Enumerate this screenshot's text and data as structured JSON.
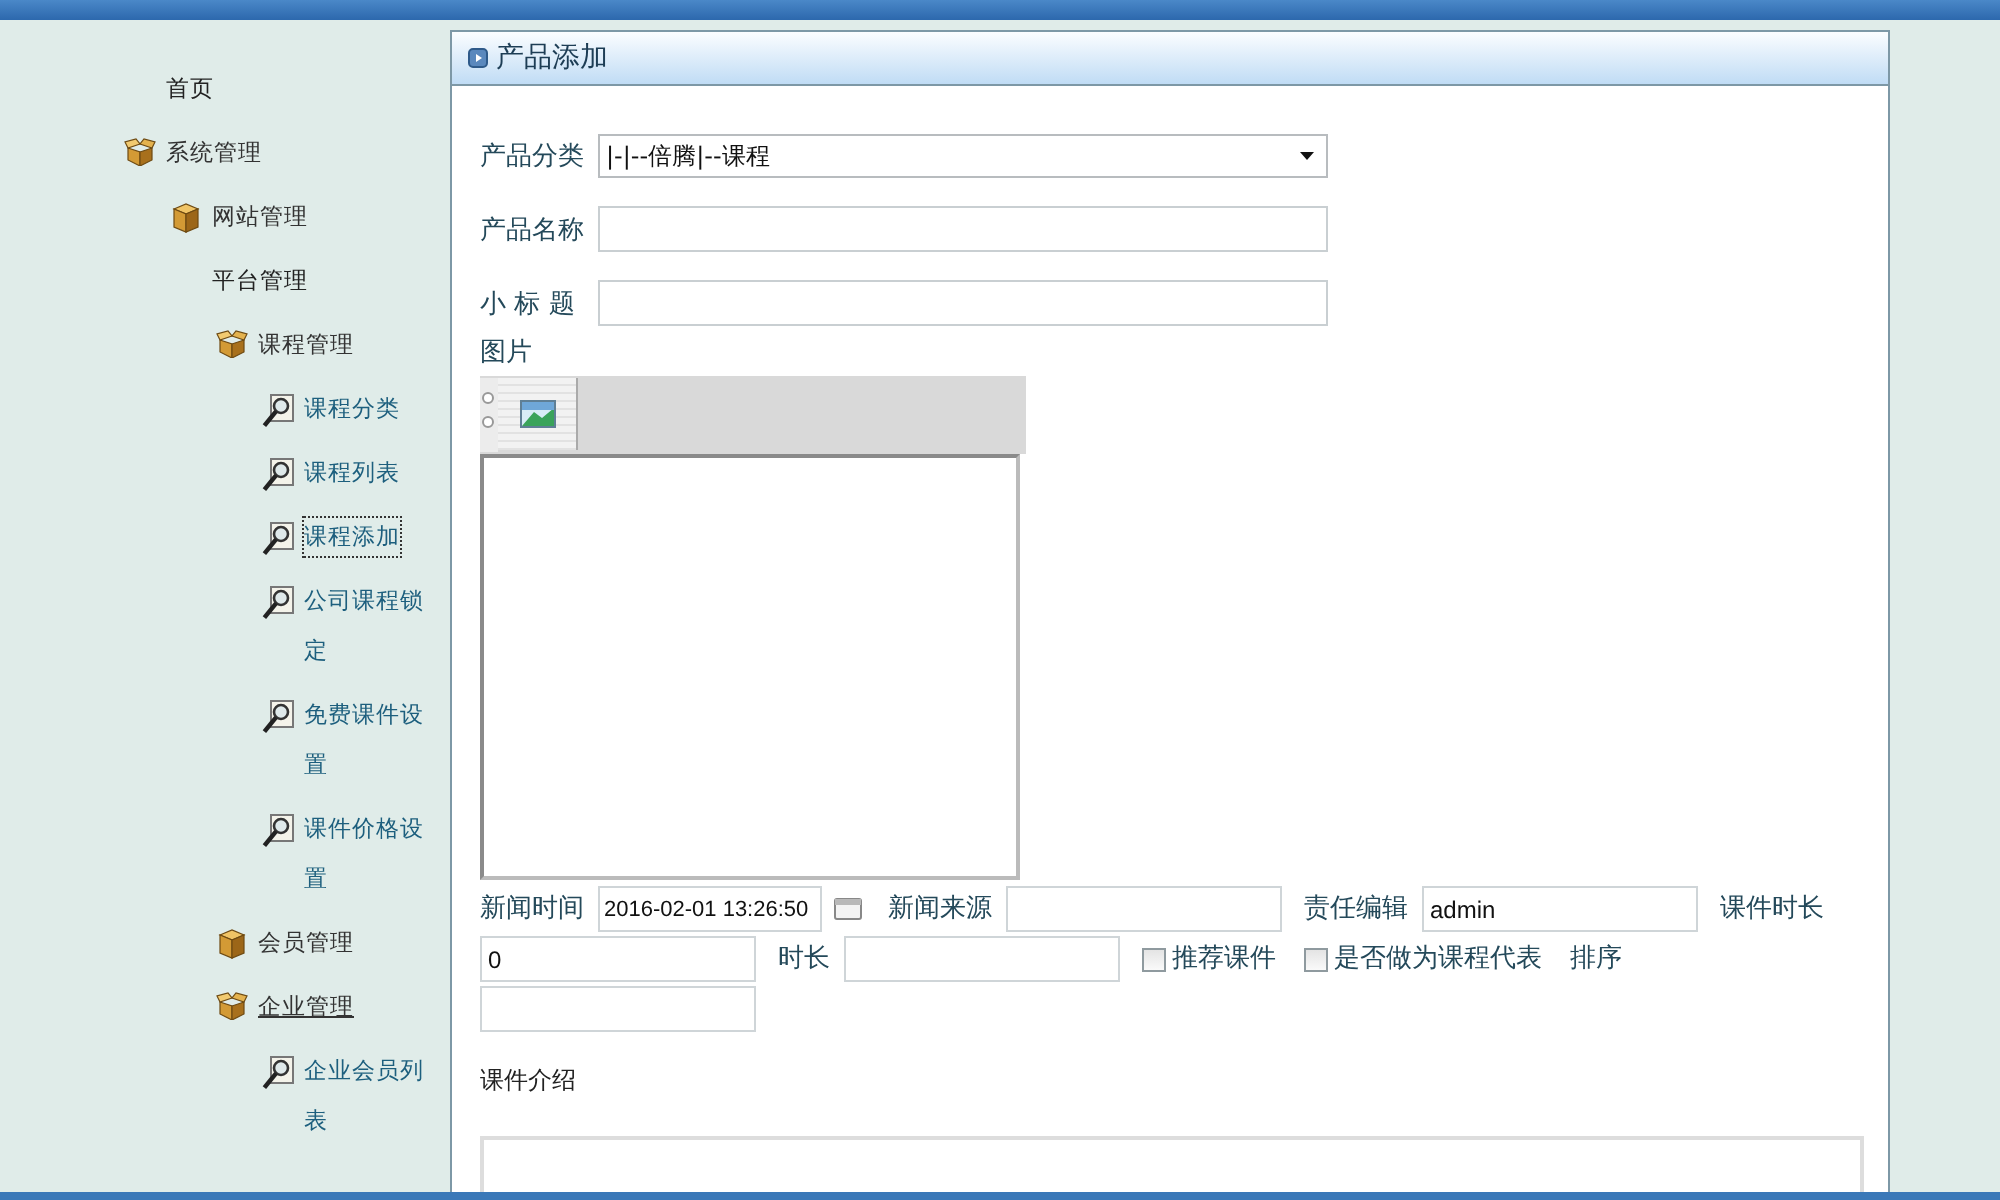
{
  "sidebar": {
    "tree": [
      {
        "label": "首页",
        "kind": "text",
        "selected": false,
        "hovered": false
      },
      {
        "label": "系统管理",
        "kind": "folder",
        "expanded": true,
        "selected": false,
        "hovered": false,
        "children": [
          {
            "label": "网站管理",
            "kind": "folder",
            "expanded": false,
            "selected": false,
            "hovered": false
          },
          {
            "label": "平台管理",
            "kind": "text",
            "selected": false,
            "hovered": false,
            "children": [
              {
                "label": "课程管理",
                "kind": "folder",
                "expanded": true,
                "selected": false,
                "hovered": false,
                "children": [
                  {
                    "label": "课程分类",
                    "kind": "link",
                    "selected": false,
                    "hovered": false
                  },
                  {
                    "label": "课程列表",
                    "kind": "link",
                    "selected": false,
                    "hovered": false
                  },
                  {
                    "label": "课程添加",
                    "kind": "link",
                    "selected": true,
                    "hovered": false
                  },
                  {
                    "label": "公司课程锁定",
                    "kind": "link",
                    "selected": false,
                    "hovered": false
                  },
                  {
                    "label": "免费课件设置",
                    "kind": "link",
                    "selected": false,
                    "hovered": false
                  },
                  {
                    "label": "课件价格设置",
                    "kind": "link",
                    "selected": false,
                    "hovered": false
                  }
                ]
              },
              {
                "label": "会员管理",
                "kind": "folder",
                "expanded": false,
                "selected": false,
                "hovered": false
              },
              {
                "label": "企业管理",
                "kind": "folder",
                "expanded": true,
                "selected": false,
                "hovered": true,
                "children": [
                  {
                    "label": "企业会员列表",
                    "kind": "link",
                    "selected": false,
                    "hovered": false
                  }
                ]
              }
            ]
          }
        ]
      }
    ]
  },
  "panel": {
    "title": "产品添加",
    "fields": [
      {
        "label": "产品分类",
        "kind": "select",
        "value": "|-|--倍腾|--课程"
      },
      {
        "label": "产品名称",
        "kind": "text"
      },
      {
        "label": "小 标 题",
        "kind": "text"
      }
    ],
    "image": {
      "label": "图片"
    },
    "inline_fields": [
      {
        "kind": "datetime",
        "label": "新闻时间",
        "value": "2016-02-01 13:26:50"
      },
      {
        "kind": "text",
        "label": "新闻来源"
      },
      {
        "kind": "text",
        "label": "责任编辑",
        "value": "admin"
      },
      {
        "kind": "label",
        "label": "课件时长"
      },
      {
        "kind": "text",
        "value": "0"
      },
      {
        "kind": "text",
        "label": "时长"
      },
      {
        "kind": "checkbox",
        "label": "推荐课件",
        "checked": false
      },
      {
        "kind": "checkbox",
        "label": "是否做为课程代表",
        "checked": false
      },
      {
        "kind": "label",
        "label": "排序"
      },
      {
        "kind": "text"
      }
    ],
    "intro": {
      "label": "课件介绍"
    }
  }
}
